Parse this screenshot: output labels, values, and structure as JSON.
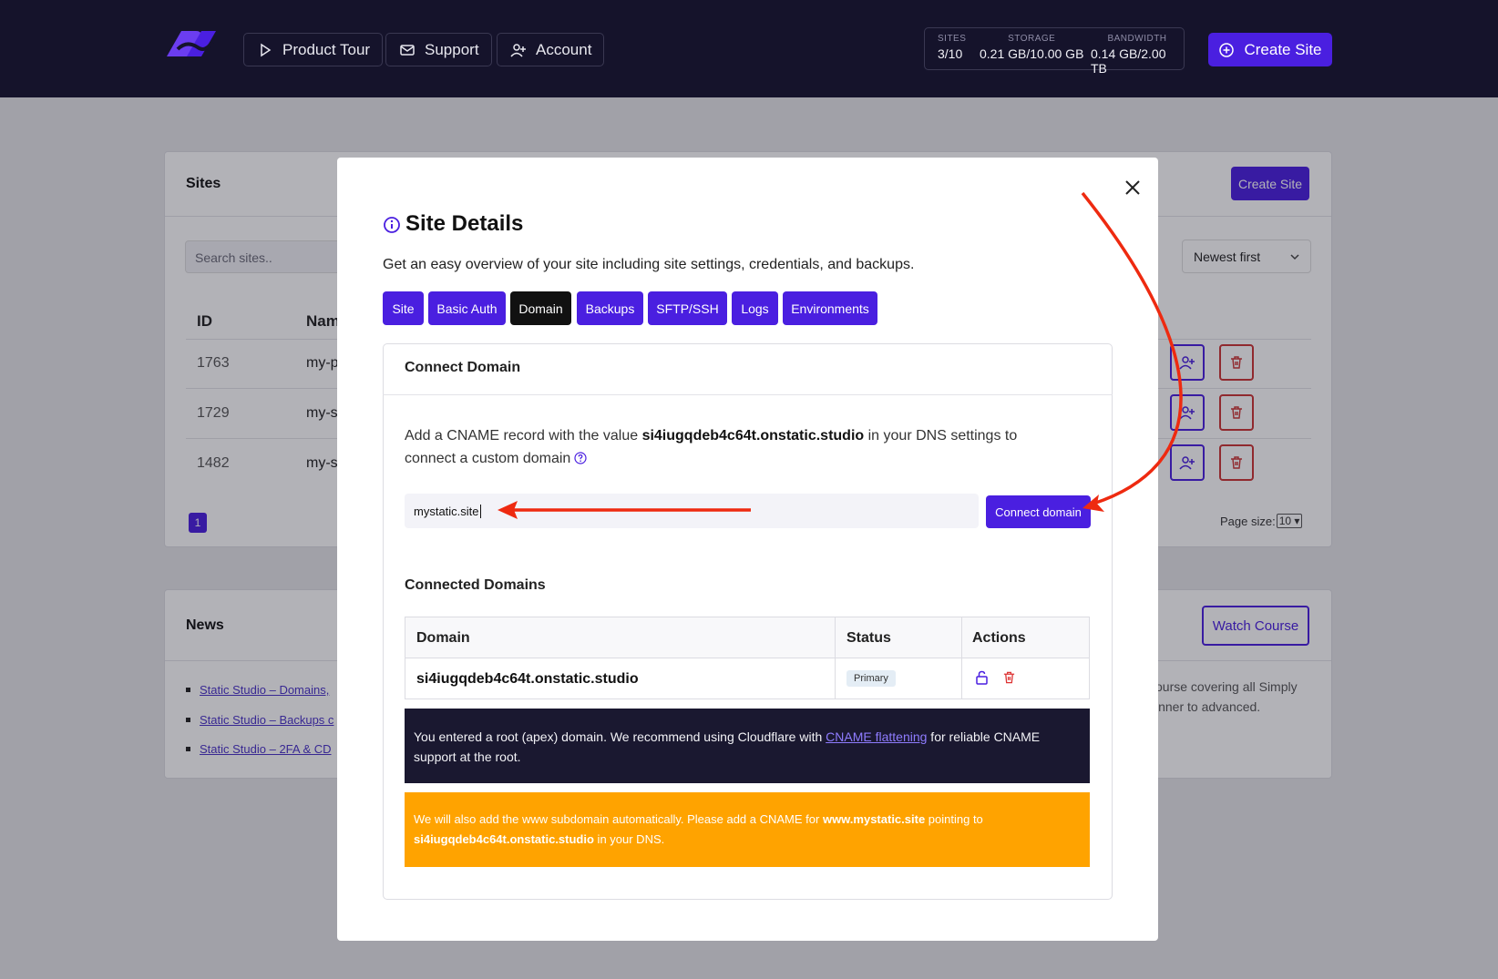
{
  "nav": {
    "product_tour": "Product Tour",
    "support": "Support",
    "account": "Account",
    "create_site": "Create Site"
  },
  "stats": {
    "sites_label": "SITES",
    "sites_value": "3/10",
    "storage_label": "STORAGE",
    "storage_value": "0.21 GB/10.00 GB",
    "bandwidth_label": "BANDWIDTH",
    "bandwidth_value": "0.14 GB/2.00 TB"
  },
  "sites": {
    "title": "Sites",
    "create_button": "Create Site",
    "search_placeholder": "Search sites..",
    "sort": "Newest first",
    "columns": [
      "ID",
      "Nam"
    ],
    "rows": [
      {
        "id": "1763",
        "name": "my-p"
      },
      {
        "id": "1729",
        "name": "my-s"
      },
      {
        "id": "1482",
        "name": "my-s"
      }
    ],
    "page": "1",
    "page_size_label": "Page size:",
    "page_size": "10"
  },
  "news": {
    "title": "News",
    "links": [
      "Static Studio – Domains,",
      "Static Studio – Backups c",
      "Static Studio – 2FA & CD"
    ],
    "watch_button": "Watch Course",
    "text_line1": "ourse covering all Simply",
    "text_line2": "inner to advanced."
  },
  "modal": {
    "title": "Site Details",
    "subtitle": "Get an easy overview of your site including site settings, credentials, and backups.",
    "tabs": [
      "Site",
      "Basic Auth",
      "Domain",
      "Backups",
      "SFTP/SSH",
      "Logs",
      "Environments"
    ],
    "active_tab": "Domain",
    "panel_title": "Connect Domain",
    "desc_before": "Add a CNAME record with the value ",
    "desc_value": "si4iugqdeb4c64t.onstatic.studio",
    "desc_after": " in your DNS settings to connect a custom domain",
    "domain_input_value": "mystatic.site",
    "connect_button": "Connect domain",
    "connected_title": "Connected Domains",
    "table_headers": [
      "Domain",
      "Status",
      "Actions"
    ],
    "table_row": {
      "domain": "si4iugqdeb4c64t.onstatic.studio",
      "status": "Primary"
    },
    "alert_dark_before": "You entered a root (apex) domain. We recommend using Cloudflare with ",
    "alert_dark_link": "CNAME flattening",
    "alert_dark_after": " for reliable CNAME support at the root.",
    "alert_orange_1": "We will also add the www subdomain automatically. Please add a CNAME for ",
    "alert_orange_www": "www.mystatic.site",
    "alert_orange_2": " pointing to ",
    "alert_orange_target": "si4iugqdeb4c64t.onstatic.studio",
    "alert_orange_3": " in your DNS."
  },
  "colors": {
    "accent": "#4a1fe0",
    "topbar": "#15132b",
    "warning": "#ffa300",
    "arrow": "#ee2a10"
  },
  "icons": [
    "logo-icon",
    "play-icon",
    "mail-icon",
    "user-plus-icon",
    "plus-circle-icon",
    "info-icon",
    "help-icon",
    "close-icon",
    "lock-icon",
    "trash-icon",
    "chevron-down-icon"
  ]
}
